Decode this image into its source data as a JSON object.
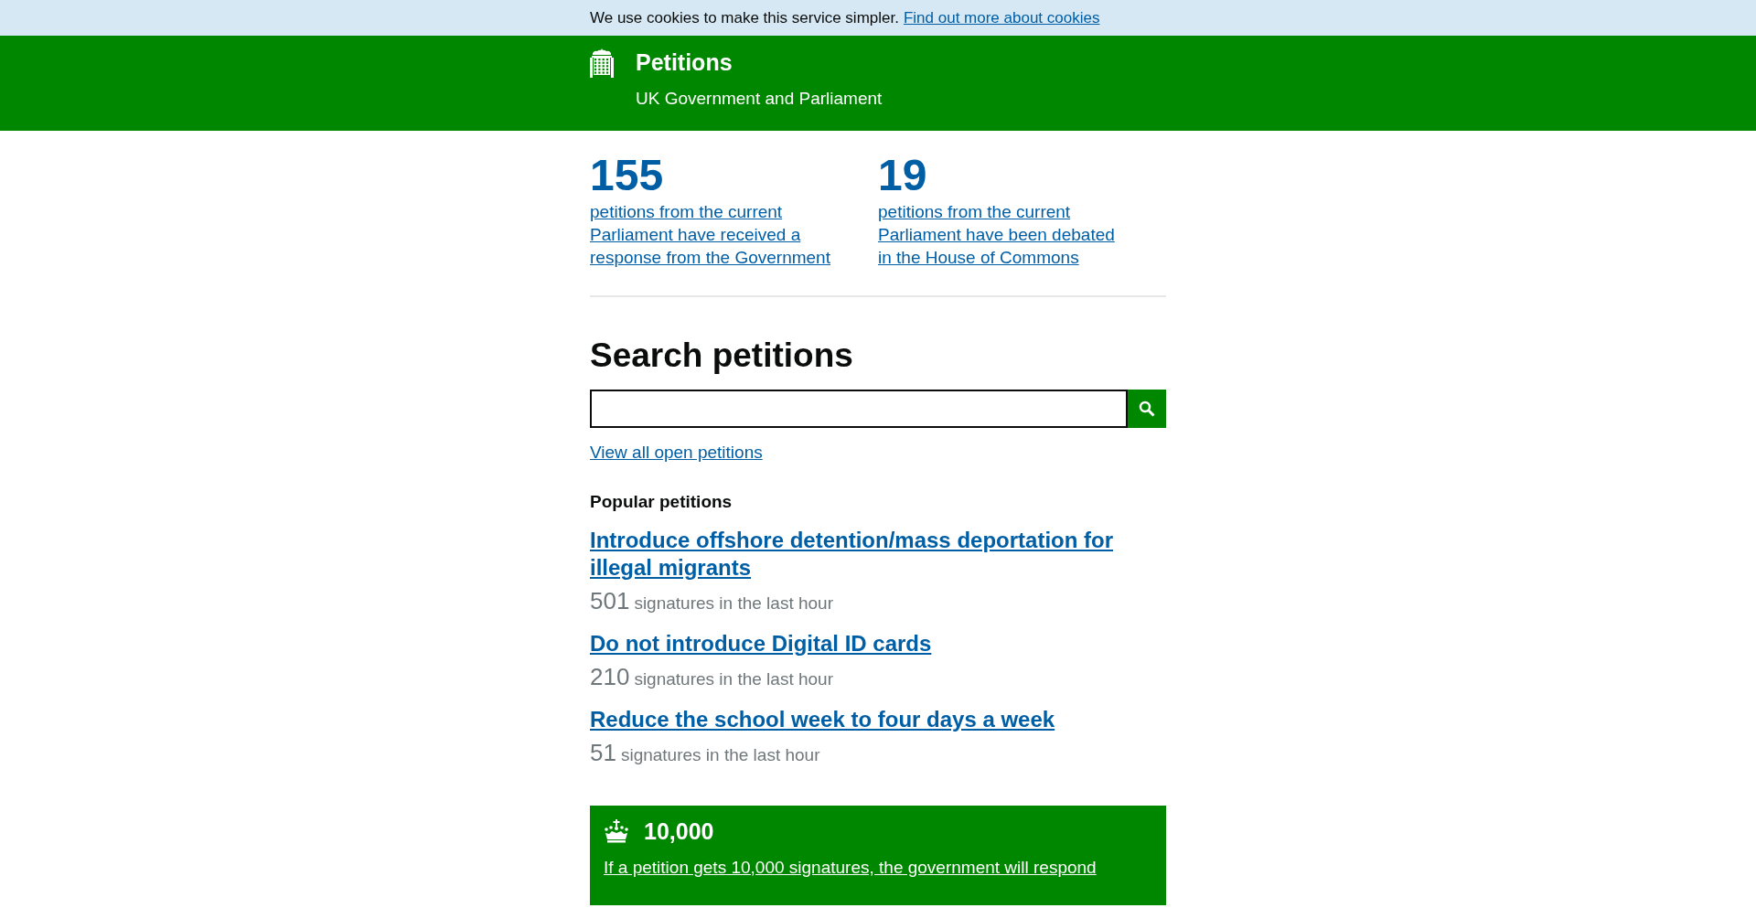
{
  "cookie_banner": {
    "text": "We use cookies to make this service simpler.",
    "link": "Find out more about cookies"
  },
  "header": {
    "title": "Petitions",
    "subtitle": "UK Government and Parliament"
  },
  "stats": [
    {
      "number": "155",
      "description": "petitions from the current Parliament have received a response from the Government"
    },
    {
      "number": "19",
      "description": "petitions from the current Parliament have been debated in the House of Commons"
    }
  ],
  "search": {
    "heading": "Search petitions",
    "view_all_link": "View all open petitions"
  },
  "popular": {
    "heading": "Popular petitions",
    "petitions": [
      {
        "title": "Introduce offshore detention/mass deportation for illegal migrants",
        "count": "501",
        "count_label": "signatures in the last hour"
      },
      {
        "title": "Do not introduce Digital ID cards",
        "count": "210",
        "count_label": "signatures in the last hour"
      },
      {
        "title": "Reduce the school week to four days a week",
        "count": "51",
        "count_label": "signatures in the last hour"
      }
    ]
  },
  "threshold": {
    "number": "10,000",
    "link": "If a petition gets 10,000 signatures, the government will respond"
  }
}
